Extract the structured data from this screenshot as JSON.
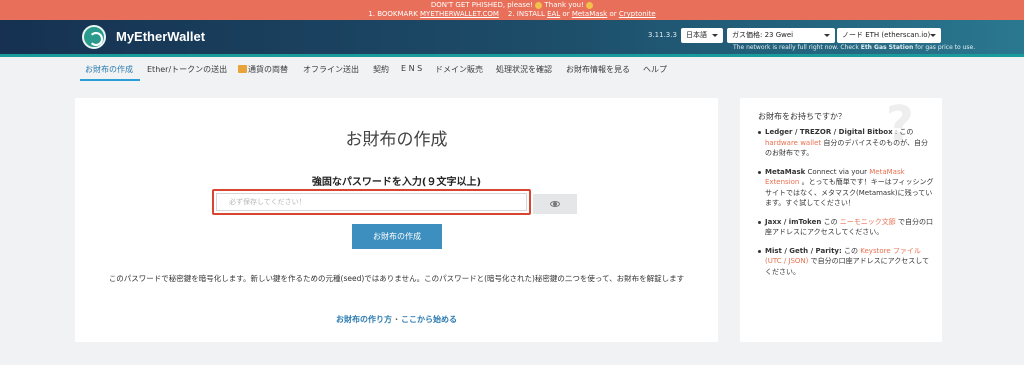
{
  "banner": {
    "line1_text": "DON'T GET PHISHED, please! ",
    "line1_thanks": " Thank you! ",
    "line2_prefix": "1. BOOKMARK ",
    "line2_bookmark": "MYETHERWALLET.COM",
    "line2_install": "    2. INSTALL ",
    "line2_eal": "EAL",
    "line2_or1": " or ",
    "line2_metamask": "MetaMask",
    "line2_or2": " or ",
    "line2_cryptonite": "Cryptonite",
    "bg_color": "#e8705a"
  },
  "header": {
    "brand": "MyEtherWallet",
    "version": "3.11.3.3",
    "language": "日本語",
    "gas": "ガス価格: 23 Gwei",
    "network": "ノード ETH (etherscan.io)",
    "network_note_prefix": "The network is really full right now. Check ",
    "network_note_link": "Eth Gas Station",
    "network_note_suffix": " for gas price to use."
  },
  "nav": {
    "items": [
      {
        "label": "お財布の作成",
        "active": true
      },
      {
        "label": "Ether/トークンの送出"
      },
      {
        "label": "通貨の両替",
        "icon": "swap-icon"
      },
      {
        "label": "オフライン送出"
      },
      {
        "label": "契約"
      },
      {
        "label": "E N S"
      },
      {
        "label": "ドメイン販売"
      },
      {
        "label": "処理状況を確認"
      },
      {
        "label": "お財布情報を見る"
      },
      {
        "label": "ヘルプ"
      }
    ]
  },
  "main": {
    "title": "お財布の作成",
    "password_label": "強固なパスワードを入力(９文字以上)",
    "password_placeholder": "必ず保存してください！",
    "create_button": "お財布の作成",
    "description": "このパスワードで秘密鍵を暗号化します。新しい鍵を作るための元種(seed)ではありません。このパスワードと(暗号化された)秘密鍵の二つを使って、お財布を解錠します",
    "link_howto": "お財布の作り方",
    "link_separator": "·",
    "link_getstarted": "ここから始める"
  },
  "sidebar": {
    "title": "お財布をお持ちですか？",
    "q_mark": "?",
    "items": [
      {
        "bold": "Ledger / TREZOR / Digital Bitbox",
        "pre": " : この",
        "link": "hardware wallet",
        "post": " 自分のデバイスそのものが、自分のお財布です。"
      },
      {
        "bold": "MetaMask",
        "pre": " Connect via your ",
        "link": "MetaMask Extension",
        "post": " 。とっても簡単です！キーはフィッシングサイトではなく、メタマスク(Metamask)に残っています。すぐ試してください！"
      },
      {
        "bold": "Jaxx / imToken",
        "pre": " この ",
        "link": "ニーモニック文節",
        "post": " で自分の口座アドレスにアクセスしてください。"
      },
      {
        "bold": "Mist / Geth / Parity:",
        "pre": " この ",
        "link": "Keystore ファイル (UTC / JSON)",
        "post": " で自分の口座アドレスにアクセスしてください。"
      }
    ]
  },
  "colors": {
    "accent": "#3d8fbf",
    "highlight": "#d9452f",
    "link_orange": "#e8704f"
  }
}
